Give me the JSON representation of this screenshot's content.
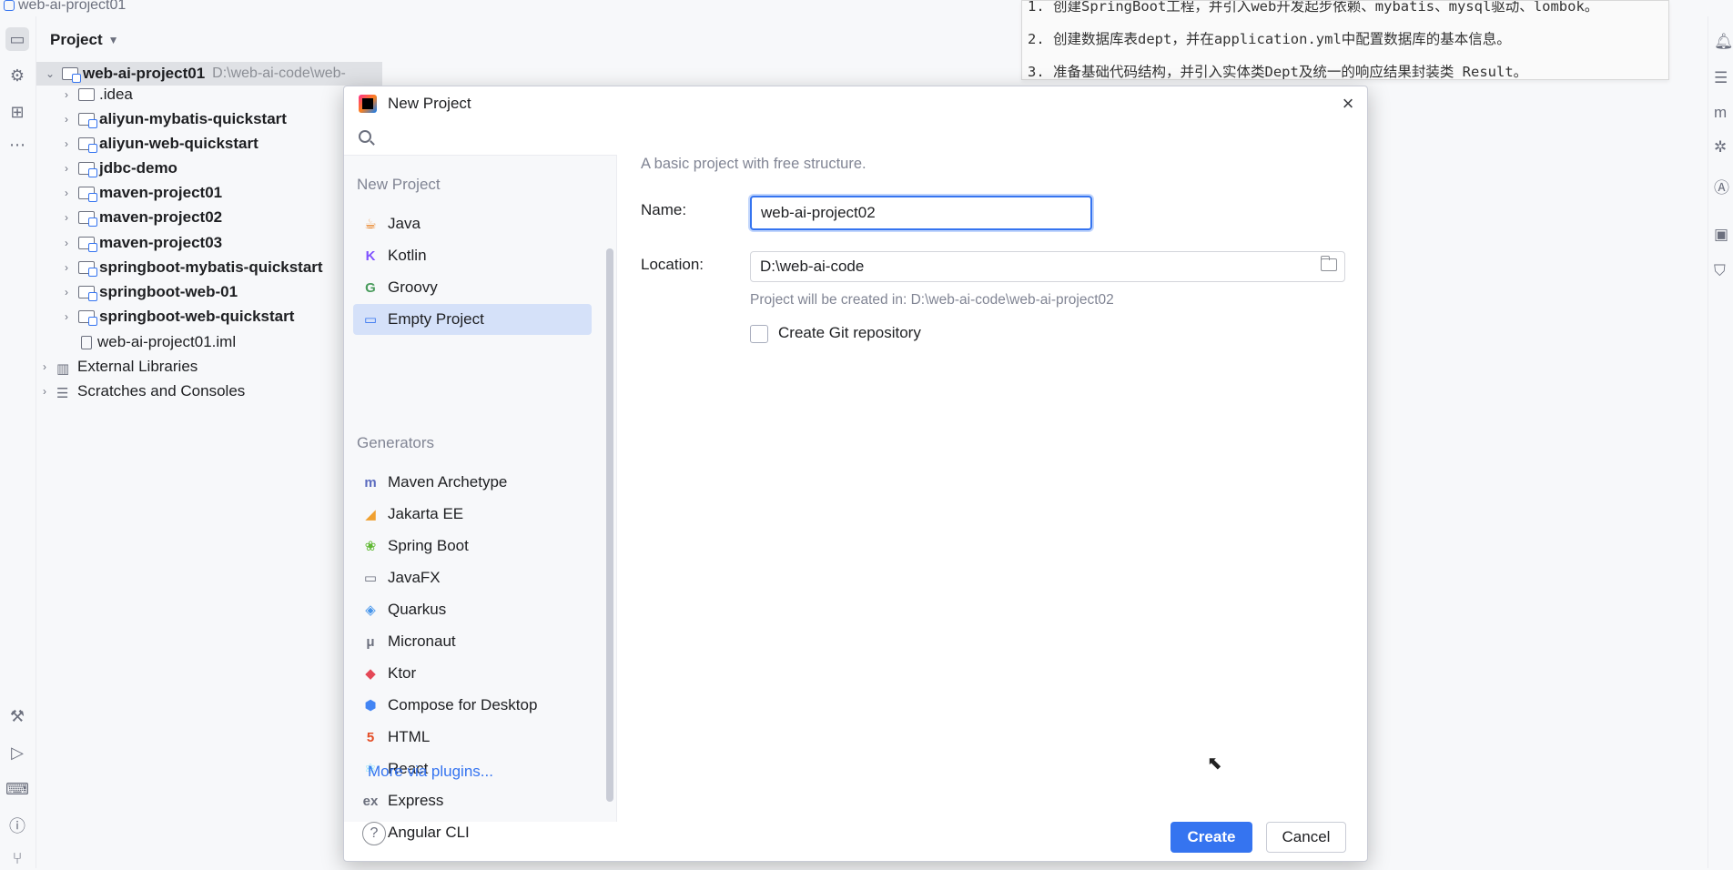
{
  "window": {
    "title": "web-ai-project01"
  },
  "left_strip": {
    "icons": [
      "folder-icon",
      "gear-icon",
      "structure-icon",
      "more-icon",
      "hammer-icon",
      "run-icon",
      "terminal-icon",
      "problems-icon",
      "git-icon"
    ]
  },
  "right_strip": {
    "icons": [
      "notifications-icon",
      "database-icon",
      "maven-icon",
      "ai-assistant-icon",
      "ai-icon",
      "translate-icon",
      "security-icon"
    ]
  },
  "project_panel": {
    "title": "Project",
    "tree": [
      {
        "label": "web-ai-project01",
        "path": "D:\\web-ai-code\\web-",
        "bold": true,
        "expanded": true,
        "type": "module"
      },
      {
        "label": ".idea",
        "bold": false,
        "type": "folder"
      },
      {
        "label": "aliyun-mybatis-quickstart",
        "bold": true,
        "type": "module"
      },
      {
        "label": "aliyun-web-quickstart",
        "bold": true,
        "type": "module"
      },
      {
        "label": "jdbc-demo",
        "bold": true,
        "type": "module"
      },
      {
        "label": "maven-project01",
        "bold": true,
        "type": "module"
      },
      {
        "label": "maven-project02",
        "bold": true,
        "type": "module"
      },
      {
        "label": "maven-project03",
        "bold": true,
        "type": "module"
      },
      {
        "label": "springboot-mybatis-quickstart",
        "bold": true,
        "type": "module"
      },
      {
        "label": "springboot-web-01",
        "bold": true,
        "type": "module"
      },
      {
        "label": "springboot-web-quickstart",
        "bold": true,
        "type": "module"
      },
      {
        "label": "web-ai-project01.iml",
        "bold": false,
        "type": "file"
      },
      {
        "label": "External Libraries",
        "bold": false,
        "type": "library"
      },
      {
        "label": "Scratches and Consoles",
        "bold": false,
        "type": "scratches"
      }
    ]
  },
  "notes": {
    "lines": [
      "1. 创建SpringBoot工程，并引入web开发起步依赖、mybatis、mysql驱动、lombok。",
      "2. 创建数据库表dept，并在application.yml中配置数据库的基本信息。",
      "3. 准备基础代码结构，并引入实体类Dept及统一的响应结果封装类 Result。"
    ]
  },
  "dialog": {
    "title": "New Project",
    "search": {
      "value": "",
      "placeholder": ""
    },
    "new_project_section": "New Project",
    "new_project_items": [
      {
        "label": "Java",
        "icon": "java-icon",
        "color": "#e76f00"
      },
      {
        "label": "Kotlin",
        "icon": "kotlin-icon",
        "color": "#7f52ff"
      },
      {
        "label": "Groovy",
        "icon": "groovy-icon",
        "color": "#4a9c5d"
      },
      {
        "label": "Empty Project",
        "icon": "empty-project-icon",
        "color": "#3574f0",
        "selected": true
      }
    ],
    "generators_section": "Generators",
    "generator_items": [
      {
        "label": "Maven Archetype",
        "icon": "maven-icon",
        "color": "#5b6bbf"
      },
      {
        "label": "Jakarta EE",
        "icon": "jakarta-ee-icon",
        "color": "#f0a030"
      },
      {
        "label": "Spring Boot",
        "icon": "spring-boot-icon",
        "color": "#5fb832"
      },
      {
        "label": "JavaFX",
        "icon": "javafx-icon",
        "color": "#6c707e"
      },
      {
        "label": "Quarkus",
        "icon": "quarkus-icon",
        "color": "#4695eb"
      },
      {
        "label": "Micronaut",
        "icon": "micronaut-icon",
        "color": "#6c707e"
      },
      {
        "label": "Ktor",
        "icon": "ktor-icon",
        "color": "#e44857"
      },
      {
        "label": "Compose for Desktop",
        "icon": "compose-icon",
        "color": "#4285f4"
      },
      {
        "label": "HTML",
        "icon": "html-icon",
        "color": "#e44d26"
      },
      {
        "label": "React",
        "icon": "react-icon",
        "color": "#61dafb"
      },
      {
        "label": "Express",
        "icon": "express-icon",
        "color": "#6c707e"
      },
      {
        "label": "Angular CLI",
        "icon": "angular-icon",
        "color": "#dd0031"
      }
    ],
    "more_plugins": "More via plugins...",
    "help": "?",
    "description": "A basic project with free structure.",
    "name_label": "Name:",
    "name_value": "web-ai-project02",
    "location_label": "Location:",
    "location_value": "D:\\web-ai-code",
    "location_hint": "Project will be created in: D:\\web-ai-code\\web-ai-project02",
    "git_label": "Create Git repository",
    "git_checked": false,
    "create_label": "Create",
    "cancel_label": "Cancel"
  },
  "colors": {
    "accent": "#3574f0",
    "selection": "#d5e1f9"
  }
}
